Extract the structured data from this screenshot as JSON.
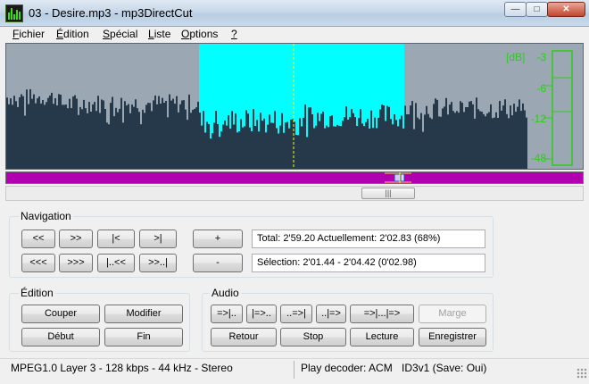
{
  "window": {
    "title": "03 - Desire.mp3 - mp3DirectCut",
    "minimize": "—",
    "maximize": "□",
    "close": "✕"
  },
  "menu": [
    {
      "first": "F",
      "rest": "ichier"
    },
    {
      "first": "É",
      "rest": "dition"
    },
    {
      "first": "S",
      "rest": "pécial"
    },
    {
      "first": "L",
      "rest": "iste"
    },
    {
      "first": "O",
      "rest": "ptions"
    },
    {
      "first": "?",
      "rest": ""
    }
  ],
  "meter": {
    "unit": "[dB]",
    "labels": [
      "-3",
      "-6",
      "-12",
      "-48"
    ]
  },
  "scroll": {
    "thumb_glyph": "|||"
  },
  "navigation": {
    "title": "Navigation",
    "buttons_row1": [
      "<<",
      ">>",
      "|<",
      ">|"
    ],
    "buttons_row2": [
      "<<<",
      ">>>",
      "|..<<",
      ">>..|"
    ],
    "zoom_in": "+",
    "zoom_out": "-",
    "total_info": "Total: 2'59.20   Actuellement: 2'02.83   (68%)",
    "selection_info": "Sélection: 2'01.44 - 2'04.42 (0'02.98)"
  },
  "edition": {
    "title": "Édition",
    "cut": "Couper",
    "modify": "Modifier",
    "start": "Début",
    "end": "Fin"
  },
  "audio": {
    "title": "Audio",
    "row1": [
      "=>|..",
      "|=>..",
      "..=>|",
      "..|=>",
      "=>|...|=>"
    ],
    "margin": "Marge",
    "back": "Retour",
    "stop": "Stop",
    "play": "Lecture",
    "record": "Enregistrer"
  },
  "status": {
    "format": "MPEG1.0 Layer 3 - 128 kbps - 44 kHz - Stereo",
    "decoder": "Play decoder: ACM",
    "id3": "ID3v1 (Save: Oui)"
  },
  "colors": {
    "wave_fill": "#26394a",
    "wave_bg": "#9ba8b3",
    "selection": "#00ffff",
    "timeline": "#b000b0",
    "meter_green": "#2ccc18"
  }
}
